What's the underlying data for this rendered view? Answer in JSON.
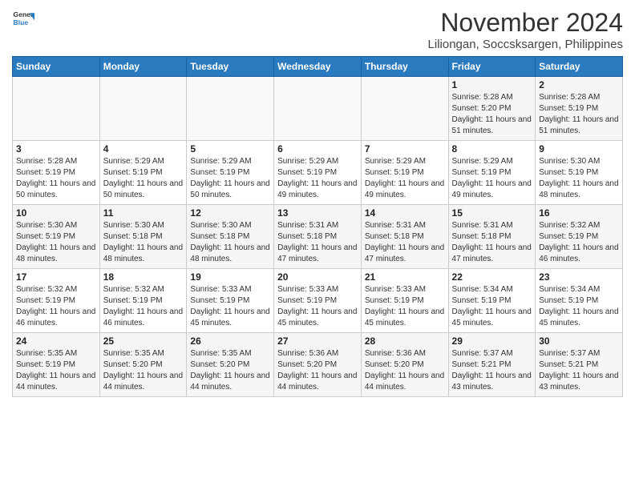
{
  "logo": {
    "general": "General",
    "blue": "Blue"
  },
  "title": "November 2024",
  "location": "Liliongan, Soccsksargen, Philippines",
  "days_of_week": [
    "Sunday",
    "Monday",
    "Tuesday",
    "Wednesday",
    "Thursday",
    "Friday",
    "Saturday"
  ],
  "weeks": [
    [
      {
        "day": "",
        "sunrise": "",
        "sunset": "",
        "daylight": ""
      },
      {
        "day": "",
        "sunrise": "",
        "sunset": "",
        "daylight": ""
      },
      {
        "day": "",
        "sunrise": "",
        "sunset": "",
        "daylight": ""
      },
      {
        "day": "",
        "sunrise": "",
        "sunset": "",
        "daylight": ""
      },
      {
        "day": "",
        "sunrise": "",
        "sunset": "",
        "daylight": ""
      },
      {
        "day": "1",
        "sunrise": "5:28 AM",
        "sunset": "5:20 PM",
        "daylight": "11 hours and 51 minutes."
      },
      {
        "day": "2",
        "sunrise": "5:28 AM",
        "sunset": "5:19 PM",
        "daylight": "11 hours and 51 minutes."
      }
    ],
    [
      {
        "day": "3",
        "sunrise": "5:28 AM",
        "sunset": "5:19 PM",
        "daylight": "11 hours and 50 minutes."
      },
      {
        "day": "4",
        "sunrise": "5:29 AM",
        "sunset": "5:19 PM",
        "daylight": "11 hours and 50 minutes."
      },
      {
        "day": "5",
        "sunrise": "5:29 AM",
        "sunset": "5:19 PM",
        "daylight": "11 hours and 50 minutes."
      },
      {
        "day": "6",
        "sunrise": "5:29 AM",
        "sunset": "5:19 PM",
        "daylight": "11 hours and 49 minutes."
      },
      {
        "day": "7",
        "sunrise": "5:29 AM",
        "sunset": "5:19 PM",
        "daylight": "11 hours and 49 minutes."
      },
      {
        "day": "8",
        "sunrise": "5:29 AM",
        "sunset": "5:19 PM",
        "daylight": "11 hours and 49 minutes."
      },
      {
        "day": "9",
        "sunrise": "5:30 AM",
        "sunset": "5:19 PM",
        "daylight": "11 hours and 48 minutes."
      }
    ],
    [
      {
        "day": "10",
        "sunrise": "5:30 AM",
        "sunset": "5:19 PM",
        "daylight": "11 hours and 48 minutes."
      },
      {
        "day": "11",
        "sunrise": "5:30 AM",
        "sunset": "5:18 PM",
        "daylight": "11 hours and 48 minutes."
      },
      {
        "day": "12",
        "sunrise": "5:30 AM",
        "sunset": "5:18 PM",
        "daylight": "11 hours and 48 minutes."
      },
      {
        "day": "13",
        "sunrise": "5:31 AM",
        "sunset": "5:18 PM",
        "daylight": "11 hours and 47 minutes."
      },
      {
        "day": "14",
        "sunrise": "5:31 AM",
        "sunset": "5:18 PM",
        "daylight": "11 hours and 47 minutes."
      },
      {
        "day": "15",
        "sunrise": "5:31 AM",
        "sunset": "5:18 PM",
        "daylight": "11 hours and 47 minutes."
      },
      {
        "day": "16",
        "sunrise": "5:32 AM",
        "sunset": "5:19 PM",
        "daylight": "11 hours and 46 minutes."
      }
    ],
    [
      {
        "day": "17",
        "sunrise": "5:32 AM",
        "sunset": "5:19 PM",
        "daylight": "11 hours and 46 minutes."
      },
      {
        "day": "18",
        "sunrise": "5:32 AM",
        "sunset": "5:19 PM",
        "daylight": "11 hours and 46 minutes."
      },
      {
        "day": "19",
        "sunrise": "5:33 AM",
        "sunset": "5:19 PM",
        "daylight": "11 hours and 45 minutes."
      },
      {
        "day": "20",
        "sunrise": "5:33 AM",
        "sunset": "5:19 PM",
        "daylight": "11 hours and 45 minutes."
      },
      {
        "day": "21",
        "sunrise": "5:33 AM",
        "sunset": "5:19 PM",
        "daylight": "11 hours and 45 minutes."
      },
      {
        "day": "22",
        "sunrise": "5:34 AM",
        "sunset": "5:19 PM",
        "daylight": "11 hours and 45 minutes."
      },
      {
        "day": "23",
        "sunrise": "5:34 AM",
        "sunset": "5:19 PM",
        "daylight": "11 hours and 45 minutes."
      }
    ],
    [
      {
        "day": "24",
        "sunrise": "5:35 AM",
        "sunset": "5:19 PM",
        "daylight": "11 hours and 44 minutes."
      },
      {
        "day": "25",
        "sunrise": "5:35 AM",
        "sunset": "5:20 PM",
        "daylight": "11 hours and 44 minutes."
      },
      {
        "day": "26",
        "sunrise": "5:35 AM",
        "sunset": "5:20 PM",
        "daylight": "11 hours and 44 minutes."
      },
      {
        "day": "27",
        "sunrise": "5:36 AM",
        "sunset": "5:20 PM",
        "daylight": "11 hours and 44 minutes."
      },
      {
        "day": "28",
        "sunrise": "5:36 AM",
        "sunset": "5:20 PM",
        "daylight": "11 hours and 44 minutes."
      },
      {
        "day": "29",
        "sunrise": "5:37 AM",
        "sunset": "5:21 PM",
        "daylight": "11 hours and 43 minutes."
      },
      {
        "day": "30",
        "sunrise": "5:37 AM",
        "sunset": "5:21 PM",
        "daylight": "11 hours and 43 minutes."
      }
    ]
  ]
}
